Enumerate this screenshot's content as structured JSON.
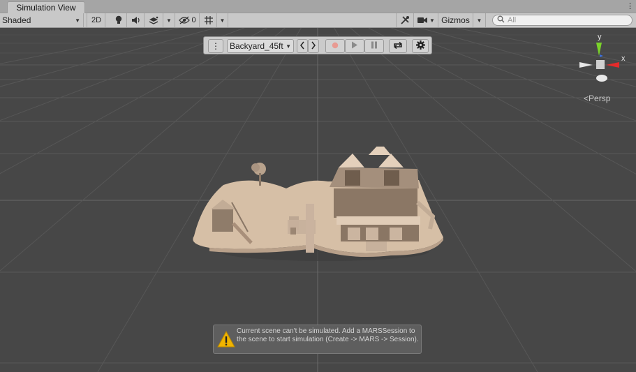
{
  "window": {
    "tab_title": "Simulation View"
  },
  "toolbar": {
    "shading_mode": "Shaded",
    "mode_2d_label": "2D",
    "hidden_count": "0",
    "gizmos_label": "Gizmos",
    "search_placeholder": "All"
  },
  "sim_toolbar": {
    "environment": "Backyard_45ft"
  },
  "gizmo": {
    "y_label": "y",
    "x_label": "x",
    "projection": "Persp"
  },
  "notification": {
    "message": "Current scene can't be simulated. Add a MARSSession to the scene to start simulation (Create -> MARS -> Session)."
  },
  "colors": {
    "viewport_bg": "#474747",
    "grid_line": "#5a5a5a",
    "toolbar_bg": "#c8c8c8",
    "axis_x": "#e32b2b",
    "axis_y": "#7ad22a",
    "axis_z": "#3a6fe0",
    "warning": "#f0b400",
    "terrain": "#d6bfa6"
  },
  "icons": [
    "kebab-menu-icon",
    "lightbulb-icon",
    "audio-icon",
    "effects-icon",
    "visibility-icon",
    "grid-icon",
    "tools-icon",
    "camera-icon",
    "search-icon",
    "prev-icon",
    "next-icon",
    "record-icon",
    "play-icon",
    "pause-icon",
    "sync-icon",
    "settings-icon",
    "warning-icon"
  ]
}
